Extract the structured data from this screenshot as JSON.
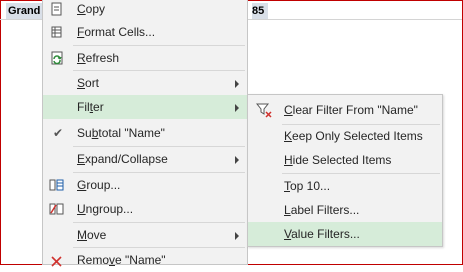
{
  "sheet": {
    "grand_total_label": "Grand T",
    "grand_total_value": "85"
  },
  "context_menu": {
    "items": [
      {
        "pre": "",
        "ul": "C",
        "post": "opy",
        "icon": "copy-icon"
      },
      {
        "pre": "",
        "ul": "F",
        "post": "ormat Cells...",
        "icon": "format-cells-icon"
      },
      {
        "pre": "",
        "ul": "R",
        "post": "efresh",
        "icon": "refresh-icon"
      },
      {
        "pre": "",
        "ul": "S",
        "post": "ort",
        "icon": ""
      },
      {
        "pre": "Fil",
        "ul": "t",
        "post": "er",
        "icon": ""
      },
      {
        "pre": "Su",
        "ul": "b",
        "post": "total \"Name\"",
        "icon": "checkmark-icon"
      },
      {
        "pre": "",
        "ul": "E",
        "post": "xpand/Collapse",
        "icon": ""
      },
      {
        "pre": "",
        "ul": "G",
        "post": "roup...",
        "icon": "group-icon"
      },
      {
        "pre": "",
        "ul": "U",
        "post": "ngroup...",
        "icon": "ungroup-icon"
      },
      {
        "pre": "",
        "ul": "M",
        "post": "ove",
        "icon": ""
      },
      {
        "pre": "Remo",
        "ul": "v",
        "post": "e \"Name\"",
        "icon": "remove-icon"
      }
    ]
  },
  "filter_submenu": {
    "items": [
      {
        "pre": "",
        "ul": "C",
        "post": "lear Filter From \"Name\"",
        "icon": "clear-filter-icon"
      },
      {
        "pre": "",
        "ul": "K",
        "post": "eep Only Selected Items",
        "icon": ""
      },
      {
        "pre": "",
        "ul": "H",
        "post": "ide Selected Items",
        "icon": ""
      },
      {
        "pre": "",
        "ul": "T",
        "post": "op 10...",
        "icon": ""
      },
      {
        "pre": "",
        "ul": "L",
        "post": "abel Filters...",
        "icon": ""
      },
      {
        "pre": "",
        "ul": "V",
        "post": "alue Filters...",
        "icon": ""
      }
    ]
  },
  "colors": {
    "highlight": "#d6ecd9",
    "menu_background": "#f2f2f2",
    "sheet_border": "#c00000"
  }
}
